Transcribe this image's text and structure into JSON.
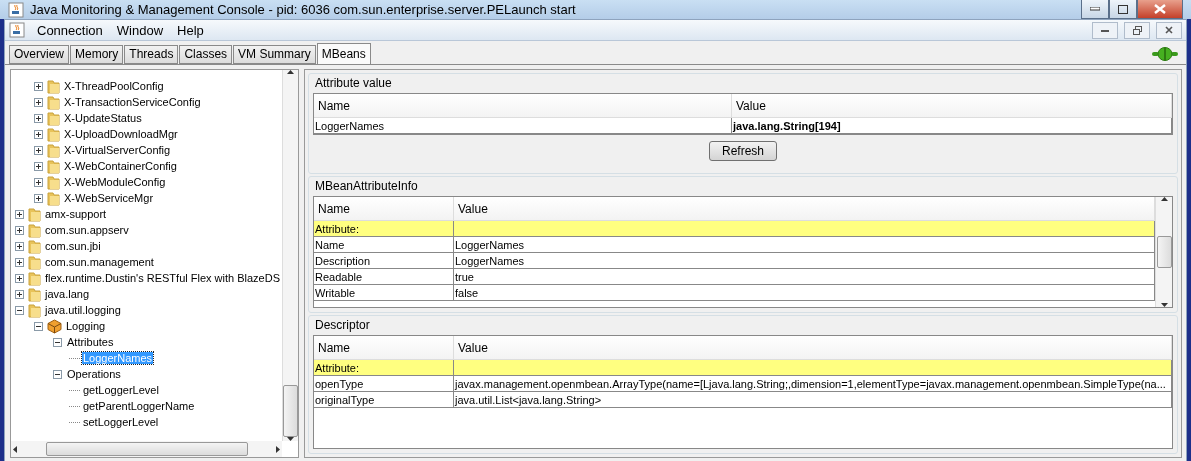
{
  "window": {
    "title": "Java Monitoring & Management Console - pid: 6036 com.sun.enterprise.server.PELaunch start"
  },
  "menu": [
    "Connection",
    "Window",
    "Help"
  ],
  "tabs": [
    {
      "label": "Overview",
      "selected": false
    },
    {
      "label": "Memory",
      "selected": false
    },
    {
      "label": "Threads",
      "selected": false
    },
    {
      "label": "Classes",
      "selected": false
    },
    {
      "label": "VM Summary",
      "selected": false
    },
    {
      "label": "MBeans",
      "selected": true
    }
  ],
  "tree": [
    {
      "kind": "hidden",
      "children": [
        {
          "label": "X-ThreadPoolConfig",
          "kind": "folder",
          "expanded": false,
          "selected": false
        },
        {
          "label": "X-TransactionServiceConfig",
          "kind": "folder",
          "expanded": false,
          "selected": false
        },
        {
          "label": "X-UpdateStatus",
          "kind": "folder",
          "expanded": false,
          "selected": false
        },
        {
          "label": "X-UploadDownloadMgr",
          "kind": "folder",
          "expanded": false,
          "selected": false
        },
        {
          "label": "X-VirtualServerConfig",
          "kind": "folder",
          "expanded": false,
          "selected": false
        },
        {
          "label": "X-WebContainerConfig",
          "kind": "folder",
          "expanded": false,
          "selected": false
        },
        {
          "label": "X-WebModuleConfig",
          "kind": "folder",
          "expanded": false,
          "selected": false
        },
        {
          "label": "X-WebServiceMgr",
          "kind": "folder",
          "expanded": false,
          "selected": false
        }
      ]
    },
    {
      "label": "amx-support",
      "kind": "folder",
      "expanded": false,
      "selected": false
    },
    {
      "label": "com.sun.appserv",
      "kind": "folder",
      "expanded": false,
      "selected": false
    },
    {
      "label": "com.sun.jbi",
      "kind": "folder",
      "expanded": false,
      "selected": false
    },
    {
      "label": "com.sun.management",
      "kind": "folder",
      "expanded": false,
      "selected": false
    },
    {
      "label": "flex.runtime.Dustin's RESTful Flex with BlazeDS",
      "kind": "folder",
      "expanded": false,
      "selected": false
    },
    {
      "label": "java.lang",
      "kind": "folder",
      "expanded": false,
      "selected": false
    },
    {
      "label": "java.util.logging",
      "kind": "folder",
      "expanded": true,
      "selected": false,
      "children": [
        {
          "label": "Logging",
          "kind": "bean",
          "expanded": true,
          "selected": false,
          "children": [
            {
              "label": "Attributes",
              "kind": "group",
              "expanded": true,
              "selected": false,
              "children": [
                {
                  "label": "LoggerNames",
                  "kind": "leaf",
                  "selected": true
                }
              ]
            },
            {
              "label": "Operations",
              "kind": "group",
              "expanded": true,
              "selected": false,
              "children": [
                {
                  "label": "getLoggerLevel",
                  "kind": "leaf",
                  "selected": false
                },
                {
                  "label": "getParentLoggerName",
                  "kind": "leaf",
                  "selected": false
                },
                {
                  "label": "setLoggerLevel",
                  "kind": "leaf",
                  "selected": false
                }
              ]
            }
          ]
        }
      ]
    }
  ],
  "attribute_value": {
    "title": "Attribute value",
    "columns": [
      "Name",
      "Value"
    ],
    "rows": [
      {
        "kind": "value",
        "cells": [
          "LoggerNames",
          "java.lang.String[194]"
        ]
      }
    ],
    "button": "Refresh"
  },
  "attribute_info": {
    "title": "MBeanAttributeInfo",
    "columns": [
      "Name",
      "Value"
    ],
    "rows": [
      {
        "kind": "section",
        "cells": [
          "Attribute:",
          ""
        ]
      },
      {
        "kind": "property",
        "cells": [
          "Name",
          "LoggerNames"
        ]
      },
      {
        "kind": "property",
        "cells": [
          "Description",
          "LoggerNames"
        ]
      },
      {
        "kind": "property",
        "cells": [
          "Readable",
          "true"
        ]
      },
      {
        "kind": "property",
        "cells": [
          "Writable",
          "false"
        ]
      }
    ]
  },
  "descriptor": {
    "title": "Descriptor",
    "columns": [
      "Name",
      "Value"
    ],
    "rows": [
      {
        "kind": "section",
        "cells": [
          "Attribute:",
          ""
        ]
      },
      {
        "kind": "property",
        "cells": [
          "openType",
          "javax.management.openmbean.ArrayType(name=[Ljava.lang.String;,dimension=1,elementType=javax.management.openmbean.SimpleType(na..."
        ]
      },
      {
        "kind": "property",
        "cells": [
          "originalType",
          "java.util.List<java.lang.String>"
        ]
      }
    ]
  }
}
